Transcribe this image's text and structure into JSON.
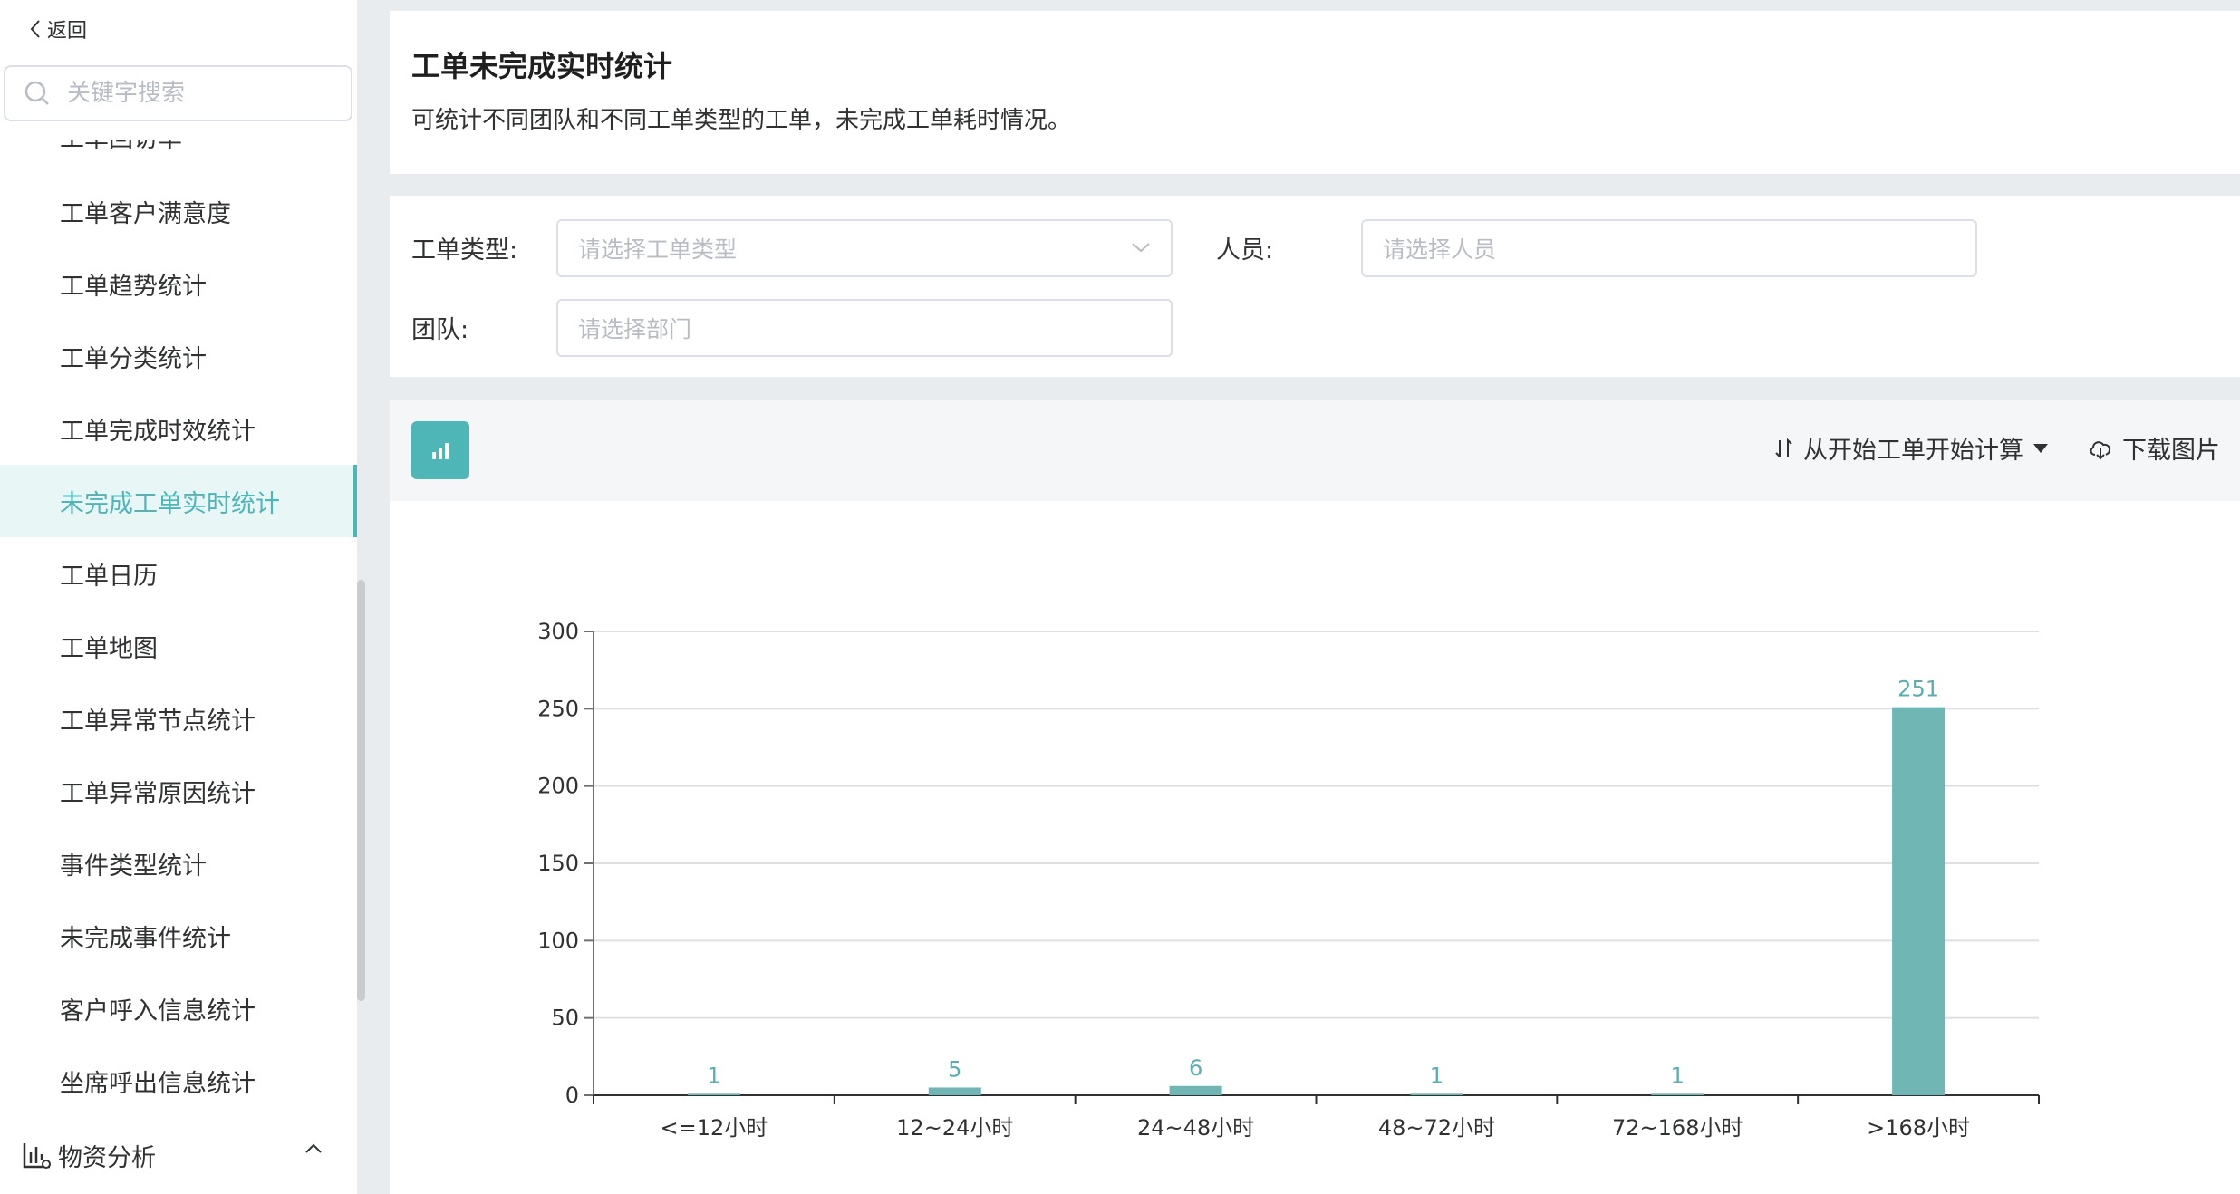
{
  "sidebar": {
    "back_label": "返回",
    "search_placeholder": "关键字搜索",
    "partial_item": "工单回访率",
    "items": [
      {
        "label": "工单客户满意度"
      },
      {
        "label": "工单趋势统计"
      },
      {
        "label": "工单分类统计"
      },
      {
        "label": "工单完成时效统计"
      },
      {
        "label": "未完成工单实时统计",
        "active": true
      },
      {
        "label": "工单日历"
      },
      {
        "label": "工单地图"
      },
      {
        "label": "工单异常节点统计"
      },
      {
        "label": "工单异常原因统计"
      },
      {
        "label": "事件类型统计"
      },
      {
        "label": "未完成事件统计"
      },
      {
        "label": "客户呼入信息统计"
      },
      {
        "label": "坐席呼出信息统计"
      }
    ],
    "group_label": "物资分析"
  },
  "header_card": {
    "title": "工单未完成实时统计",
    "description": "可统计不同团队和不同工单类型的工单，未完成工单耗时情况。"
  },
  "filters": {
    "type_label": "工单类型:",
    "type_placeholder": "请选择工单类型",
    "person_label": "人员:",
    "person_placeholder": "请选择人员",
    "team_label": "团队:",
    "team_placeholder": "请选择部门"
  },
  "toolbar": {
    "sort_label": "从开始工单开始计算",
    "download_label": "下载图片"
  },
  "colors": {
    "accent": "#4fb6b8",
    "bar": "#6fb6b5",
    "bar_label": "#5aaeb0"
  },
  "chart_data": {
    "type": "bar",
    "categories": [
      "<=12小时",
      "12~24小时",
      "24~48小时",
      "48~72小时",
      "72~168小时",
      ">168小时"
    ],
    "values": [
      1,
      5,
      6,
      1,
      1,
      251
    ],
    "ylim": [
      0,
      300
    ],
    "yticks": [
      0,
      50,
      100,
      150,
      200,
      250,
      300
    ],
    "grid": true,
    "data_labels": true
  }
}
